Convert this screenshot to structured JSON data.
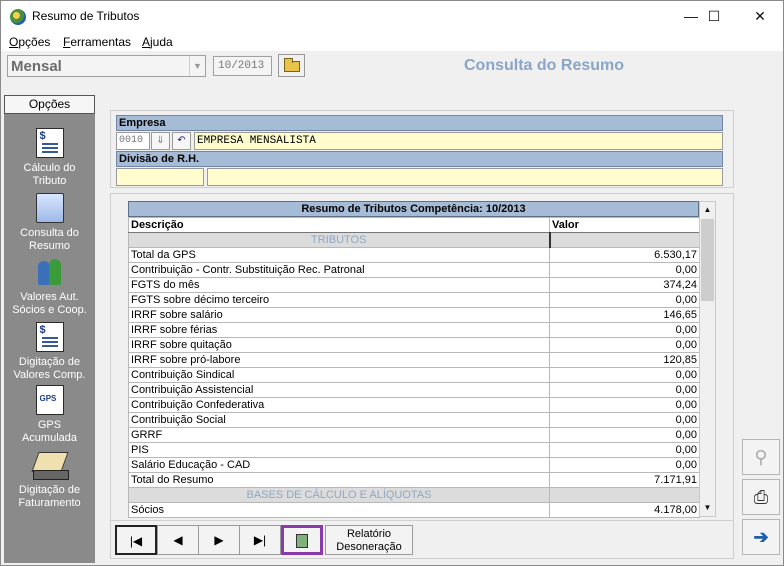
{
  "window": {
    "title": "Resumo de Tributos",
    "minimize_glyph": "—",
    "maximize_glyph": "☐",
    "close_glyph": "✕"
  },
  "menu": [
    {
      "accel": "O",
      "rest": "pções"
    },
    {
      "accel": "F",
      "rest": "erramentas"
    },
    {
      "accel": "A",
      "rest": "juda"
    }
  ],
  "toolbar": {
    "mode_value": "Mensal",
    "period_value": "10/2013",
    "page_title": "Consulta do Resumo"
  },
  "sidebar": {
    "options_button": "Opções",
    "items": [
      {
        "line1": "Cálculo do",
        "line2": "Tributo",
        "icon": "calculator-doc-icon"
      },
      {
        "line1": "Consulta do",
        "line2": "Resumo",
        "icon": "computer-icon"
      },
      {
        "line1": "Valores Aut.",
        "line2": "Sócios e  Coop.",
        "icon": "people-icon"
      },
      {
        "line1": "Digitação de",
        "line2": "Valores Comp.",
        "icon": "money-doc-icon"
      },
      {
        "line1": "GPS",
        "line2": "Acumulada",
        "icon": "gps-doc-icon"
      },
      {
        "line1": "Digitação de",
        "line2": "Faturamento",
        "icon": "laptop-icon"
      }
    ]
  },
  "empresa": {
    "label": "Empresa",
    "code": "0010",
    "name": "EMPRESA MENSALISTA"
  },
  "divisao": {
    "label": "Divisão de R.H.",
    "code": "",
    "name": ""
  },
  "grid": {
    "title": "Resumo de Tributos Competência: 10/2013",
    "col_desc": "Descrição",
    "col_value": "Valor",
    "section1": "TRIBUTOS",
    "rows": [
      {
        "desc": "Total da GPS",
        "value": "6.530,17"
      },
      {
        "desc": "Contribuição - Contr. Substituição Rec. Patronal",
        "value": "0,00"
      },
      {
        "desc": "FGTS do mês",
        "value": "374,24"
      },
      {
        "desc": "FGTS sobre décimo terceiro",
        "value": "0,00"
      },
      {
        "desc": "IRRF sobre salário",
        "value": "146,65"
      },
      {
        "desc": "IRRF sobre férias",
        "value": "0,00"
      },
      {
        "desc": "IRRF sobre quitação",
        "value": "0,00"
      },
      {
        "desc": "IRRF sobre pró-labore",
        "value": "120,85"
      },
      {
        "desc": "Contribuição Sindical",
        "value": "0,00"
      },
      {
        "desc": "Contribuição Assistencial",
        "value": "0,00"
      },
      {
        "desc": "Contribuição Confederativa",
        "value": "0,00"
      },
      {
        "desc": "Contribuição Social",
        "value": "0,00"
      },
      {
        "desc": "GRRF",
        "value": "0,00"
      },
      {
        "desc": "PIS",
        "value": "0,00"
      },
      {
        "desc": "Salário Educação - CAD",
        "value": "0,00"
      },
      {
        "desc": "Total do Resumo",
        "value": "7.171,91"
      }
    ],
    "section2": "BASES DE CÁLCULO E ALÍQUOTAS",
    "rows2": [
      {
        "desc": "Sócios",
        "value": "4.178,00"
      }
    ]
  },
  "nav": {
    "first": "|◀",
    "prev": "◀",
    "next": "▶",
    "last": "▶|",
    "report_line1": "Relatório",
    "report_line2": "Desoneração"
  }
}
